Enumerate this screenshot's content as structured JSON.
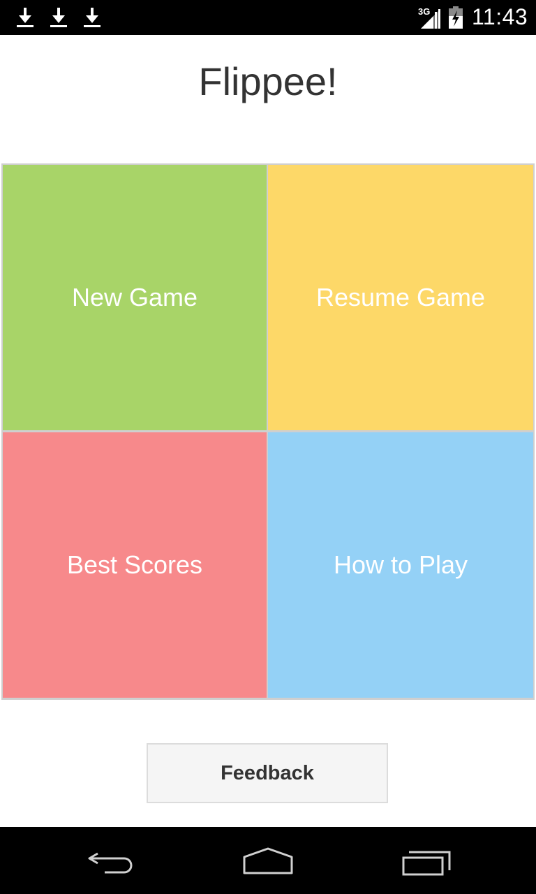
{
  "status_bar": {
    "notifications": [
      "download-icon",
      "download-icon",
      "download-icon"
    ],
    "network_type": "3G",
    "time": "11:43"
  },
  "app": {
    "title": "Flippee!"
  },
  "menu": {
    "tiles": [
      {
        "label": "New Game",
        "color": "#a8d468"
      },
      {
        "label": "Resume Game",
        "color": "#fdd868"
      },
      {
        "label": "Best Scores",
        "color": "#f7898b"
      },
      {
        "label": "How to Play",
        "color": "#94d1f6"
      }
    ]
  },
  "feedback": {
    "label": "Feedback"
  },
  "nav_bar": {
    "buttons": [
      "back-icon",
      "home-icon",
      "recents-icon"
    ]
  }
}
